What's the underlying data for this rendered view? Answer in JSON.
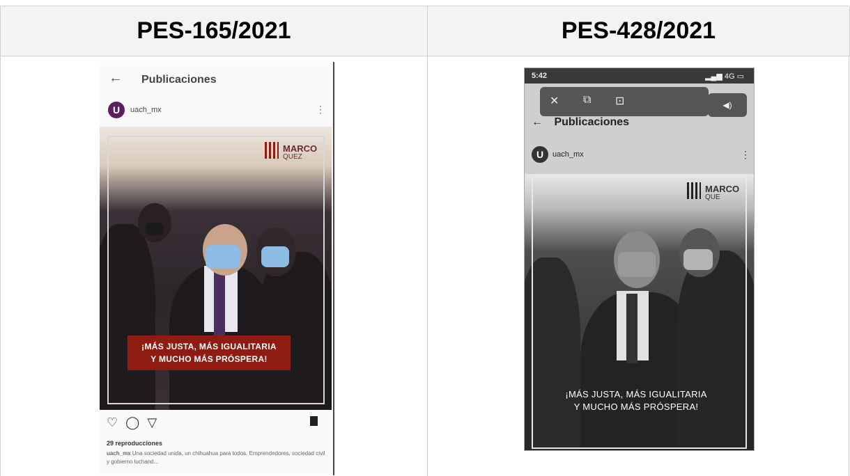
{
  "table": {
    "headers": [
      "PES-165/2021",
      "PES-428/2021"
    ]
  },
  "left_screenshot": {
    "header_title": "Publicaciones",
    "account": "uach_mx",
    "logo_letter": "U",
    "brand_line1": "MARCO",
    "brand_line2": "QUEZ",
    "banner_line1": "¡MÁS JUSTA, MÁS IGUALITARIA",
    "banner_line2": "Y MUCHO MÁS PRÓSPERA!",
    "views": "29 reproducciones",
    "caption_user": "uach_mx",
    "caption_text": "Una sociedad unida, un chihuahua para todos. Emprendedores, sociedad civil y gobierno luchand..."
  },
  "right_screenshot": {
    "time": "5:42",
    "signal": "4G",
    "header_title": "Publicaciones",
    "account": "uach_mx",
    "logo_letter": "U",
    "brand_line1": "MARCO",
    "brand_line2": "QUE",
    "banner_line1": "¡MÁS JUSTA, MÁS IGUALITARIA",
    "banner_line2": "Y MUCHO MÁS PRÓSPERA!"
  },
  "icons": [
    "back-arrow-icon",
    "heart-icon",
    "comment-icon",
    "share-icon",
    "bookmark-icon",
    "close-icon",
    "picture-in-picture-icon",
    "fullscreen-icon",
    "volume-icon",
    "kebab-menu-icon"
  ]
}
